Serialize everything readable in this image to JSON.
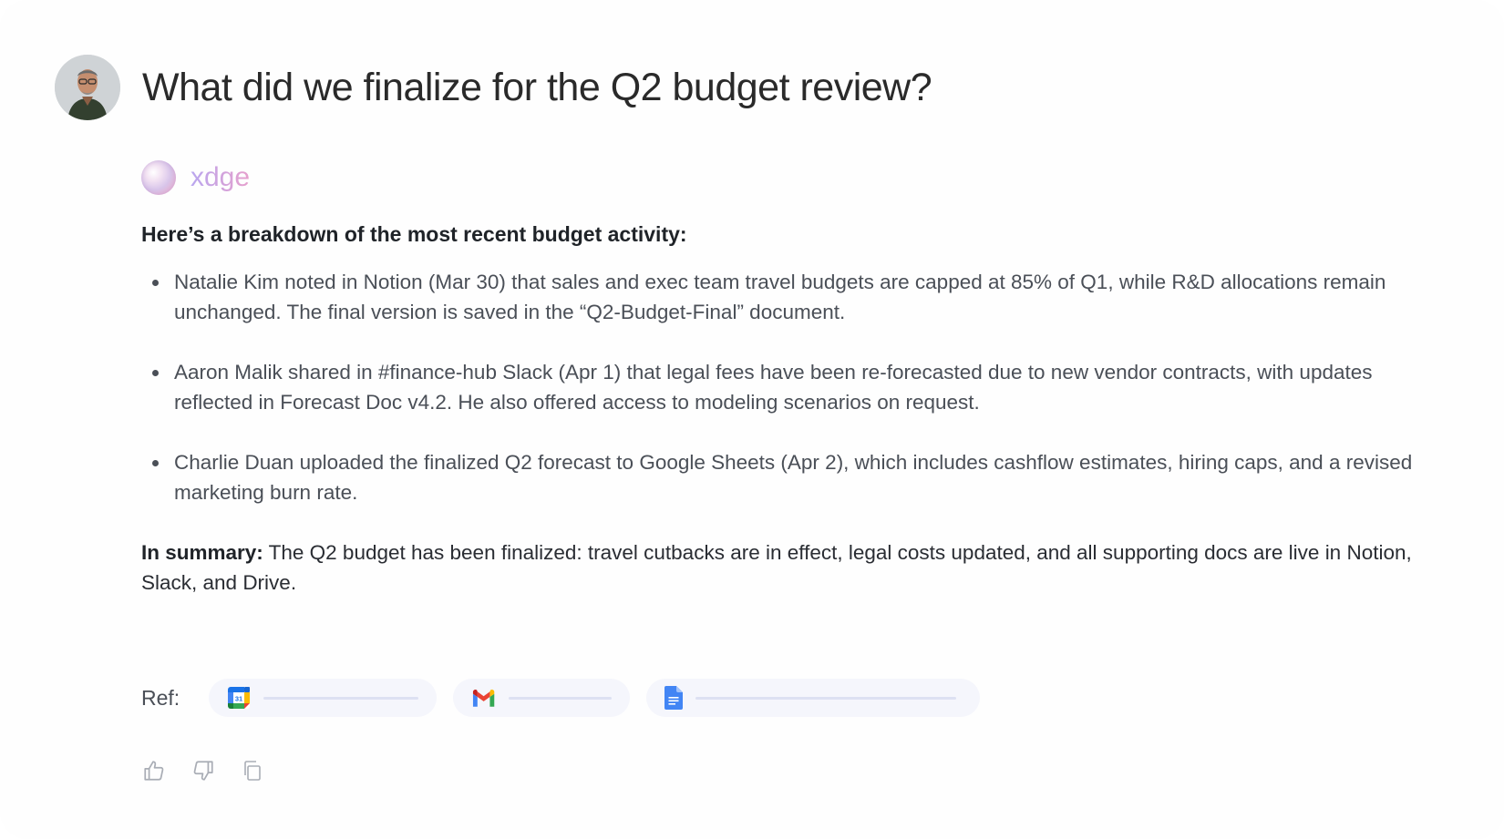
{
  "question": {
    "text": "What did we finalize for the Q2 budget review?"
  },
  "assistant": {
    "name": "xdge"
  },
  "answer": {
    "lead": "Here’s a breakdown of the most recent budget activity:",
    "bullets": [
      "Natalie Kim noted in Notion (Mar 30) that sales and exec team travel budgets are capped at 85% of Q1, while R&D allocations remain unchanged. The final version is saved in the “Q2-Budget-Final” document.",
      "Aaron Malik shared in #finance-hub Slack (Apr 1) that legal fees have been re-forecasted due to new vendor contracts, with updates reflected in Forecast Doc v4.2. He also offered access to modeling scenarios on request.",
      "Charlie Duan uploaded the finalized Q2 forecast to Google Sheets (Apr 2), which includes cashflow estimates, hiring caps, and a revised marketing burn rate."
    ],
    "summary_label": "In summary:",
    "summary_text": " The Q2 budget has been finalized: travel cutbacks are in effect, legal costs updated, and all supporting docs are live in Notion, Slack, and Drive."
  },
  "refs": {
    "label": "Ref:",
    "items": [
      {
        "icon": "google-calendar-icon",
        "calendar_day": "31"
      },
      {
        "icon": "gmail-icon"
      },
      {
        "icon": "google-docs-icon"
      }
    ]
  },
  "actions": [
    {
      "icon": "thumbs-up-icon"
    },
    {
      "icon": "thumbs-down-icon"
    },
    {
      "icon": "copy-icon"
    }
  ],
  "colors": {
    "brand_gradient_start": "#b9a6ef",
    "brand_gradient_end": "#e6a0cd",
    "chip_background": "#f5f6fc"
  }
}
